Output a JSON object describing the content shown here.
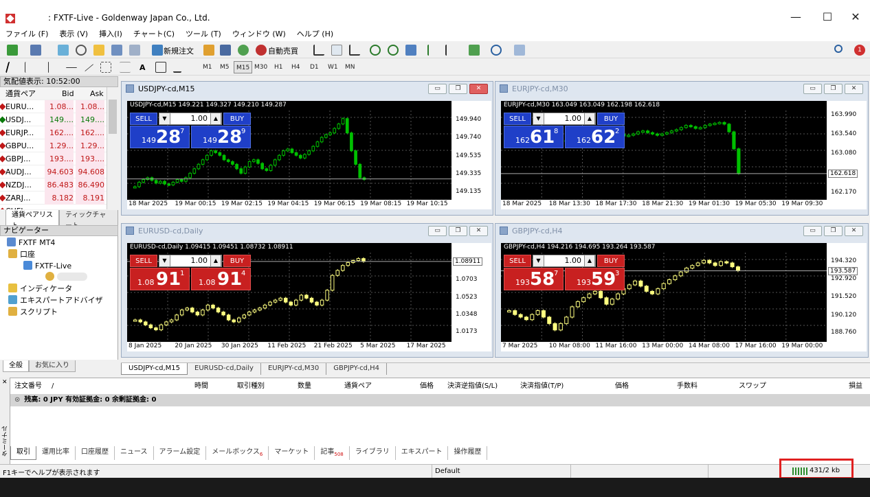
{
  "window": {
    "title": ": FXTF-Live - Goldenway Japan Co., Ltd.",
    "min": "—",
    "max": "☐",
    "close": "✕"
  },
  "menu": [
    "ファイル (F)",
    "表示 (V)",
    "挿入(I)",
    "チャート(C)",
    "ツール (T)",
    "ウィンドウ (W)",
    "ヘルプ (H)"
  ],
  "toolbar": {
    "new_order": "新規注文",
    "auto_trade": "自動売買",
    "text_tool": "A",
    "timeframes": [
      "M1",
      "M5",
      "M15",
      "M30",
      "H1",
      "H4",
      "D1",
      "W1",
      "MN"
    ],
    "active_tf": "M15",
    "notif_count": "1"
  },
  "market_watch": {
    "title": "気配値表示: 10:52:00",
    "headers": {
      "symbol": "通貨ペア",
      "bid": "Bid",
      "ask": "Ask"
    },
    "rows": [
      {
        "symbol": "EURU...",
        "bid": "1.08...",
        "ask": "1.08...",
        "dir": "dn"
      },
      {
        "symbol": "USDJ...",
        "bid": "149....",
        "ask": "149....",
        "dir": "up"
      },
      {
        "symbol": "EURJP...",
        "bid": "162....",
        "ask": "162....",
        "dir": "dn"
      },
      {
        "symbol": "GBPU...",
        "bid": "1.29...",
        "ask": "1.29...",
        "dir": "dn"
      },
      {
        "symbol": "GBPJ...",
        "bid": "193....",
        "ask": "193....",
        "dir": "dn"
      },
      {
        "symbol": "AUDJ...",
        "bid": "94.603",
        "ask": "94.608",
        "dir": "dn"
      },
      {
        "symbol": "NZDJ...",
        "bid": "86.483",
        "ask": "86.490",
        "dir": "dn"
      },
      {
        "symbol": "ZARJ...",
        "bid": "8.182",
        "ask": "8.191",
        "dir": "dn"
      },
      {
        "symbol": "CHFJ...",
        "bid": "",
        "ask": "",
        "dir": "dn"
      }
    ],
    "tabs": [
      "通貨ペアリスト",
      "ティックチャート"
    ]
  },
  "navigator": {
    "title": "ナビゲーター",
    "root": "FXTF MT4",
    "accounts": "口座",
    "live": "FXTF-Live",
    "indicators": "インディケータ",
    "experts": "エキスパートアドバイザ",
    "scripts": "スクリプト",
    "tabs": [
      "全般",
      "お気に入り"
    ]
  },
  "charts": [
    {
      "id": "usdjpy",
      "title": "USDJPY-cd,M15",
      "label": "USDJPY-cd,M15  149.221 149.327 149.210 149.287",
      "color": "#00c000",
      "y_ticks": [
        "149.940",
        "149.740",
        "149.535",
        "149.335",
        "149.135"
      ],
      "current": "149.287",
      "x_ticks": [
        "18 Mar 2025",
        "19 Mar 00:15",
        "19 Mar 02:15",
        "19 Mar 04:15",
        "19 Mar 06:15",
        "19 Mar 08:15",
        "19 Mar 10:15"
      ],
      "sell_small": "149",
      "sell_big": "28",
      "sell_sup": "7",
      "buy_small": "149",
      "buy_big": "28",
      "buy_sup": "9",
      "panel": "blue",
      "lot": "1.00",
      "sell": "SELL",
      "buy": "BUY",
      "closes": [
        149.2,
        149.25,
        149.28,
        149.3,
        149.27,
        149.24,
        149.26,
        149.23,
        149.22,
        149.25,
        149.28,
        149.26,
        149.3,
        149.35,
        149.4,
        149.45,
        149.5,
        149.55,
        149.6,
        149.58,
        149.55,
        149.5,
        149.48,
        149.45,
        149.4,
        149.35,
        149.42,
        149.48,
        149.5,
        149.46,
        149.4,
        149.38,
        149.44,
        149.5,
        149.55,
        149.6,
        149.62,
        149.58,
        149.55,
        149.52,
        149.56,
        149.6,
        149.65,
        149.7,
        149.75,
        149.78,
        149.8,
        149.85,
        149.9,
        149.96,
        149.8,
        149.6,
        149.45,
        149.3,
        149.28
      ],
      "ymin": 149.1,
      "ymax": 150.05
    },
    {
      "id": "eurjpy",
      "title": "EURJPY-cd,M30",
      "label": "EURJPY-cd,M30  163.049 163.049 162.198 162.618",
      "color": "#00c000",
      "y_ticks": [
        "163.990",
        "163.540",
        "163.080",
        "162.618",
        "162.170"
      ],
      "current": "162.618",
      "x_ticks": [
        "18 Mar 2025",
        "18 Mar 13:30",
        "18 Mar 17:30",
        "18 Mar 21:30",
        "19 Mar 01:30",
        "19 Mar 05:30",
        "19 Mar 09:30"
      ],
      "sell_small": "162",
      "sell_big": "61",
      "sell_sup": "8",
      "buy_small": "162",
      "buy_big": "62",
      "buy_sup": "2",
      "panel": "blue",
      "lot": "1.00",
      "sell": "SELL",
      "buy": "BUY",
      "closes": [
        163.4,
        163.42,
        163.45,
        163.4,
        163.38,
        163.35,
        163.3,
        163.28,
        163.25,
        163.3,
        163.35,
        163.38,
        163.4,
        163.42,
        163.45,
        163.5,
        163.55,
        163.52,
        163.55,
        163.58,
        163.6,
        163.62,
        163.58,
        163.55,
        163.5,
        163.52,
        163.55,
        163.6,
        163.62,
        163.58,
        163.55,
        163.52,
        163.55,
        163.58,
        163.62,
        163.65,
        163.7,
        163.75,
        163.72,
        163.68,
        163.7,
        163.75,
        163.78,
        163.8,
        163.82,
        163.78,
        163.6,
        163.2,
        162.618
      ],
      "ymin": 162.1,
      "ymax": 164.1
    },
    {
      "id": "eurusd",
      "title": "EURUSD-cd,Daily",
      "label": "EURUSD-cd,Daily  1.09415 1.09451 1.08732 1.08911",
      "color": "#ffff80",
      "y_ticks": [
        "1.08911",
        "1.0703",
        "1.0523",
        "1.0348",
        "1.0173"
      ],
      "current": "1.08911",
      "x_ticks": [
        "8 Jan 2025",
        "20 Jan 2025",
        "30 Jan 2025",
        "11 Feb 2025",
        "21 Feb 2025",
        "5 Mar 2025",
        "17 Mar 2025"
      ],
      "sell_small": "1.08",
      "sell_big": "91",
      "sell_sup": "1",
      "buy_small": "1.08",
      "buy_big": "91",
      "buy_sup": "4",
      "panel": "red",
      "lot": "1.00",
      "sell": "SELL",
      "buy": "BUY",
      "closes": [
        1.03,
        1.028,
        1.025,
        1.022,
        1.02,
        1.025,
        1.028,
        1.03,
        1.035,
        1.04,
        1.042,
        1.038,
        1.035,
        1.04,
        1.045,
        1.042,
        1.038,
        1.035,
        1.03,
        1.028,
        1.032,
        1.035,
        1.038,
        1.04,
        1.042,
        1.045,
        1.048,
        1.05,
        1.052,
        1.048,
        1.045,
        1.05,
        1.055,
        1.052,
        1.048,
        1.045,
        1.05,
        1.06,
        1.075,
        1.08,
        1.085,
        1.088,
        1.09,
        1.092,
        1.089
      ],
      "ymin": 1.012,
      "ymax": 1.098
    },
    {
      "id": "gbpjpy",
      "title": "GBPJPY-cd,H4",
      "label": "GBPJPY-cd,H4  194.216 194.695 193.264 193.587",
      "color": "#ffff80",
      "y_ticks": [
        "194.320",
        "193.587",
        "192.920",
        "191.520",
        "190.120",
        "188.760"
      ],
      "current": "193.587",
      "x_ticks": [
        "7 Mar 2025",
        "10 Mar 08:00",
        "11 Mar 16:00",
        "13 Mar 00:00",
        "14 Mar 08:00",
        "17 Mar 16:00",
        "19 Mar 00:00"
      ],
      "sell_small": "193",
      "sell_big": "58",
      "sell_sup": "7",
      "buy_small": "193",
      "buy_big": "59",
      "buy_sup": "3",
      "panel": "red",
      "lot": "1.00",
      "sell": "SELL",
      "buy": "BUY",
      "closes": [
        190.5,
        190.2,
        190.0,
        189.8,
        190.2,
        190.5,
        190.0,
        189.5,
        189.0,
        189.5,
        190.0,
        190.8,
        191.2,
        191.5,
        191.8,
        192.0,
        191.5,
        191.0,
        191.4,
        191.8,
        192.2,
        192.5,
        192.8,
        192.4,
        192.0,
        191.8,
        192.2,
        192.6,
        192.9,
        193.2,
        193.5,
        193.8,
        194.0,
        194.2,
        194.4,
        194.2,
        194.0,
        194.3,
        194.2,
        193.9,
        193.587
      ],
      "ymin": 188.4,
      "ymax": 195.0
    }
  ],
  "chart_tabs": [
    "USDJPY-cd,M15",
    "EURUSD-cd,Daily",
    "EURJPY-cd,M30",
    "GBPJPY-cd,H4"
  ],
  "terminal": {
    "headers": [
      "注文番号",
      "/",
      "時間",
      "取引種別",
      "数量",
      "通貨ペア",
      "価格",
      "決済逆指値(S/L)",
      "決済指値(T/P)",
      "価格",
      "手数料",
      "スワップ",
      "損益"
    ],
    "balance": "残高: 0 JPY  有効証拠金: 0  余剰証拠金: 0",
    "side": "ターミナル",
    "tabs": [
      {
        "label": "取引",
        "badge": ""
      },
      {
        "label": "運用比率",
        "badge": ""
      },
      {
        "label": "口座履歴",
        "badge": ""
      },
      {
        "label": "ニュース",
        "badge": ""
      },
      {
        "label": "アラーム設定",
        "badge": ""
      },
      {
        "label": "メールボックス",
        "badge": "6"
      },
      {
        "label": "マーケット",
        "badge": ""
      },
      {
        "label": "記事",
        "badge": "508"
      },
      {
        "label": "ライブラリ",
        "badge": ""
      },
      {
        "label": "エキスパート",
        "badge": ""
      },
      {
        "label": "操作履歴",
        "badge": ""
      }
    ]
  },
  "status": {
    "help": "F1キーでヘルプが表示されます",
    "profile": "Default",
    "traffic": "431/2 kb"
  },
  "colors": {
    "up": "#0a7a0a",
    "down": "#c01818",
    "bull_m": "#00c000",
    "bull_d": "#ffff80",
    "highlight": "#e02020"
  }
}
